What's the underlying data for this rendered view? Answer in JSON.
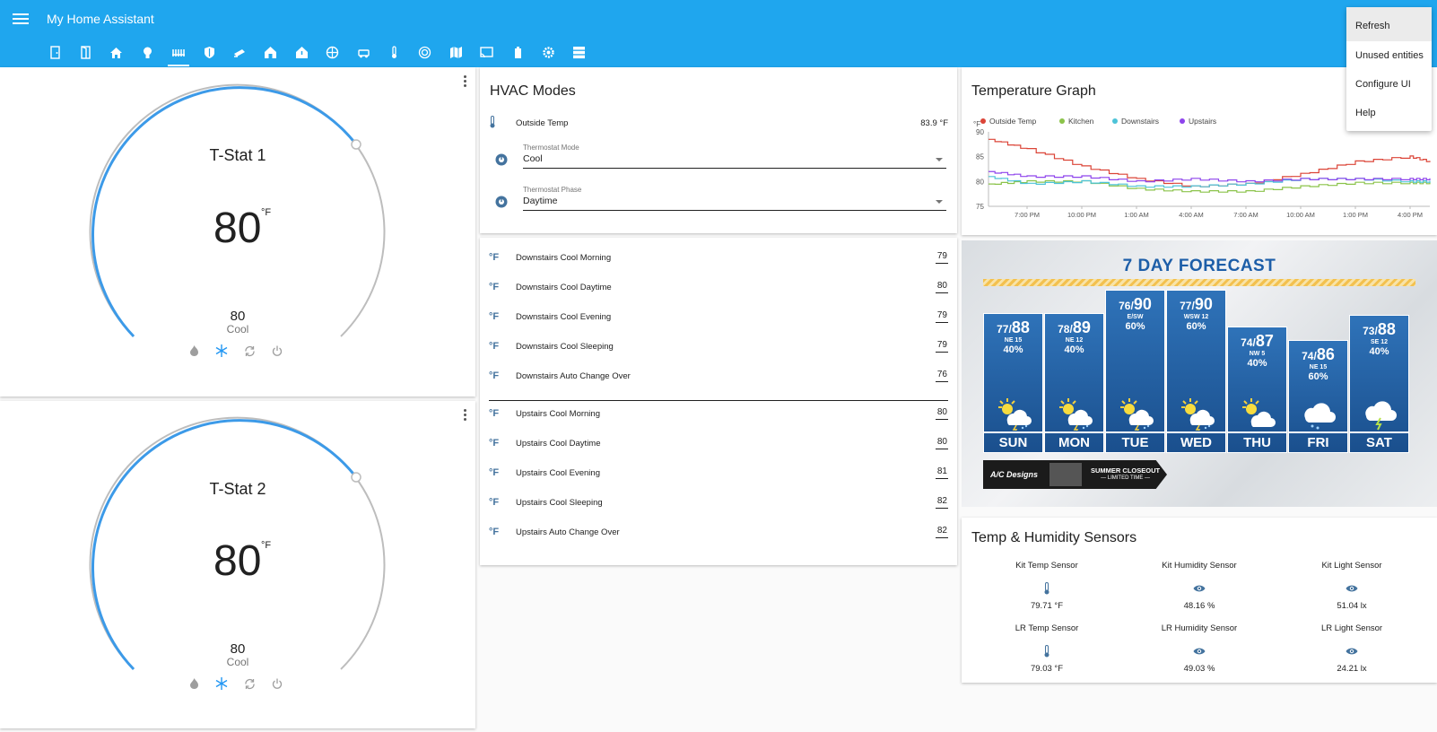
{
  "app": {
    "title": "My Home Assistant"
  },
  "tabs": [
    {
      "icon": "door-icon"
    },
    {
      "icon": "door-open-icon"
    },
    {
      "icon": "home-icon"
    },
    {
      "icon": "lightbulb-icon"
    },
    {
      "icon": "radiator-icon",
      "active": true
    },
    {
      "icon": "shield-icon"
    },
    {
      "icon": "cctv-icon"
    },
    {
      "icon": "house-icon"
    },
    {
      "icon": "house-alert-icon"
    },
    {
      "icon": "network-icon"
    },
    {
      "icon": "car-icon"
    },
    {
      "icon": "thermometer-icon"
    },
    {
      "icon": "radar-icon"
    },
    {
      "icon": "map-icon"
    },
    {
      "icon": "cast-icon"
    },
    {
      "icon": "battery-icon"
    },
    {
      "icon": "gear-icon"
    },
    {
      "icon": "server-icon"
    }
  ],
  "menu": {
    "items": [
      "Refresh",
      "Unused entities",
      "Configure UI",
      "Help"
    ]
  },
  "thermostats": [
    {
      "name": "T-Stat 1",
      "current": "80",
      "unit": "°F",
      "target": "80",
      "mode": "Cool",
      "level": 0.82
    },
    {
      "name": "T-Stat 2",
      "current": "80",
      "unit": "°F",
      "target": "80",
      "mode": "Cool",
      "level": 0.82
    }
  ],
  "hvac": {
    "title": "HVAC Modes",
    "outside_label": "Outside Temp",
    "outside_value": "83.9 °F",
    "mode_label": "Thermostat Mode",
    "mode_value": "Cool",
    "phase_label": "Thermostat Phase",
    "phase_value": "Daytime"
  },
  "setpoints": {
    "unit_icon": "°F",
    "downstairs": [
      {
        "label": "Downstairs Cool Morning",
        "value": "79"
      },
      {
        "label": "Downstairs Cool Daytime",
        "value": "80"
      },
      {
        "label": "Downstairs Cool Evening",
        "value": "79"
      },
      {
        "label": "Downstairs Cool Sleeping",
        "value": "79"
      },
      {
        "label": "Downstairs Auto Change Over",
        "value": "76"
      }
    ],
    "upstairs": [
      {
        "label": "Upstairs Cool Morning",
        "value": "80"
      },
      {
        "label": "Upstairs Cool Daytime",
        "value": "80"
      },
      {
        "label": "Upstairs Cool Evening",
        "value": "81"
      },
      {
        "label": "Upstairs Cool Sleeping",
        "value": "82"
      },
      {
        "label": "Upstairs Auto Change Over",
        "value": "82"
      }
    ]
  },
  "graph": {
    "title": "Temperature Graph",
    "unit": "°F",
    "legend": [
      "Outside Temp",
      "Kitchen",
      "Downstairs",
      "Upstairs"
    ],
    "colors": [
      "#db4437",
      "#8bc34a",
      "#4dc3d8",
      "#8e44ec"
    ],
    "y_ticks": [
      "90",
      "85",
      "80",
      "75"
    ],
    "x_ticks": [
      "7:00 PM",
      "10:00 PM",
      "1:00 AM",
      "4:00 AM",
      "7:00 AM",
      "10:00 AM",
      "1:00 PM",
      "4:00 PM"
    ]
  },
  "chart_data": {
    "type": "line",
    "title": "Temperature Graph",
    "ylabel": "°F",
    "ylim": [
      75,
      90
    ],
    "x": [
      "5:30 PM",
      "7:00 PM",
      "10:00 PM",
      "1:00 AM",
      "4:00 AM",
      "7:00 AM",
      "10:00 AM",
      "1:00 PM",
      "4:00 PM",
      "5:00 PM"
    ],
    "series": [
      {
        "name": "Outside Temp",
        "values": [
          88.5,
          86.5,
          83,
          80.5,
          79,
          79.5,
          81.5,
          84,
          85,
          84
        ]
      },
      {
        "name": "Kitchen",
        "values": [
          79.5,
          80,
          80,
          78.5,
          78,
          78,
          79,
          79.7,
          79.7,
          79.7
        ]
      },
      {
        "name": "Downstairs",
        "values": [
          81,
          79.5,
          80,
          79,
          79,
          79.5,
          80.5,
          80.5,
          80,
          80
        ]
      },
      {
        "name": "Upstairs",
        "values": [
          82,
          81,
          81,
          80,
          80.5,
          80,
          80.5,
          80.5,
          80.5,
          80.5
        ]
      }
    ]
  },
  "forecast": {
    "title": "7 DAY FORECAST",
    "days": [
      {
        "day": "SUN",
        "lo": "77",
        "hi": "88",
        "wind": "NE 15",
        "pct": "40%",
        "icon": "sun-cloud-storm"
      },
      {
        "day": "MON",
        "lo": "78",
        "hi": "89",
        "wind": "NE 12",
        "pct": "40%",
        "icon": "sun-cloud-storm"
      },
      {
        "day": "TUE",
        "lo": "76",
        "hi": "90",
        "wind": "E/SW",
        "pct": "60%",
        "icon": "sun-cloud-storm"
      },
      {
        "day": "WED",
        "lo": "77",
        "hi": "90",
        "wind": "WSW 12",
        "pct": "60%",
        "icon": "sun-cloud-storm"
      },
      {
        "day": "THU",
        "lo": "74",
        "hi": "87",
        "wind": "NW 5",
        "pct": "40%",
        "icon": "sun-cloud"
      },
      {
        "day": "FRI",
        "lo": "74",
        "hi": "86",
        "wind": "NE 15",
        "pct": "60%",
        "icon": "cloud-rain"
      },
      {
        "day": "SAT",
        "lo": "73",
        "hi": "88",
        "wind": "SE 12",
        "pct": "40%",
        "icon": "cloud-lightning"
      }
    ],
    "ad_brand": "A/C Designs",
    "ad_line1": "SUMMER CLOSEOUT",
    "ad_line2": "— LIMITED TIME —"
  },
  "sensors": {
    "title": "Temp & Humidity Sensors",
    "items": [
      {
        "name": "Kit Temp Sensor",
        "value": "79.71 °F",
        "icon": "thermometer-icon"
      },
      {
        "name": "Kit Humidity Sensor",
        "value": "48.16 %",
        "icon": "eye-icon"
      },
      {
        "name": "Kit Light Sensor",
        "value": "51.04 lx",
        "icon": "eye-icon"
      },
      {
        "name": "LR Temp Sensor",
        "value": "79.03 °F",
        "icon": "thermometer-icon"
      },
      {
        "name": "LR Humidity Sensor",
        "value": "49.03 %",
        "icon": "eye-icon"
      },
      {
        "name": "LR Light Sensor",
        "value": "24.21 lx",
        "icon": "eye-icon"
      }
    ]
  }
}
